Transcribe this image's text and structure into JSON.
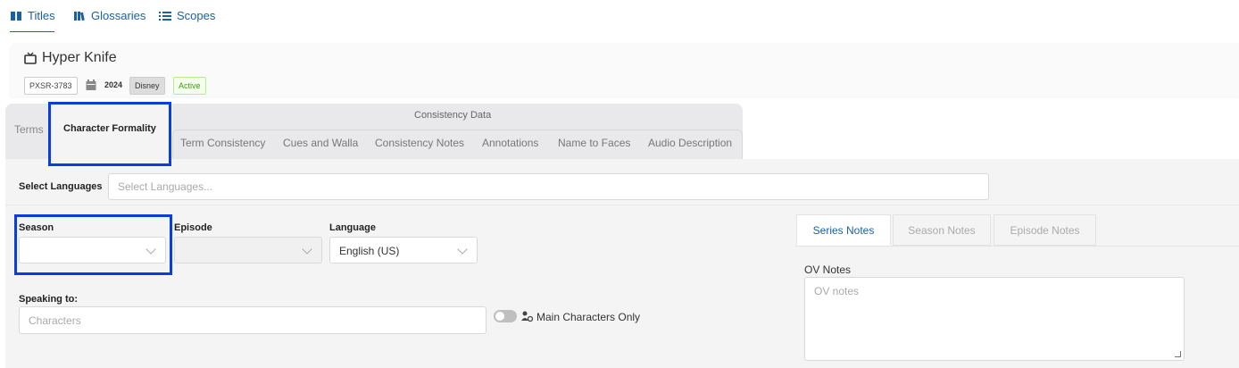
{
  "nav": {
    "items": [
      {
        "label": "Titles",
        "icon": "book-icon"
      },
      {
        "label": "Glossaries",
        "icon": "books-icon"
      },
      {
        "label": "Scopes",
        "icon": "list-icon"
      }
    ]
  },
  "title": {
    "name": "Hyper Knife",
    "icon": "tv-icon",
    "id_tag": "PXSR-3783",
    "year": "2024",
    "studio_tag": "Disney",
    "status_tag": "Active"
  },
  "tabs": {
    "terms": "Terms",
    "character_formality": "Character Formality",
    "group_label": "Consistency Data",
    "subtabs": [
      "Term Consistency",
      "Cues and Walla",
      "Consistency Notes",
      "Annotations",
      "Name to Faces",
      "Audio Description"
    ]
  },
  "filters": {
    "select_languages_label": "Select Languages",
    "select_languages_placeholder": "Select Languages...",
    "season_label": "Season",
    "season_value": "",
    "episode_label": "Episode",
    "episode_value": "",
    "language_label": "Language",
    "language_value": "English (US)",
    "speaking_to_label": "Speaking to:",
    "characters_placeholder": "Characters",
    "main_characters_label": "Main Characters Only"
  },
  "notes": {
    "tabs": [
      "Series Notes",
      "Season Notes",
      "Episode Notes"
    ],
    "ov_label": "OV Notes",
    "ov_placeholder": "OV notes"
  },
  "colors": {
    "accent": "#1a5fa8",
    "highlight": "#0a3de0"
  }
}
